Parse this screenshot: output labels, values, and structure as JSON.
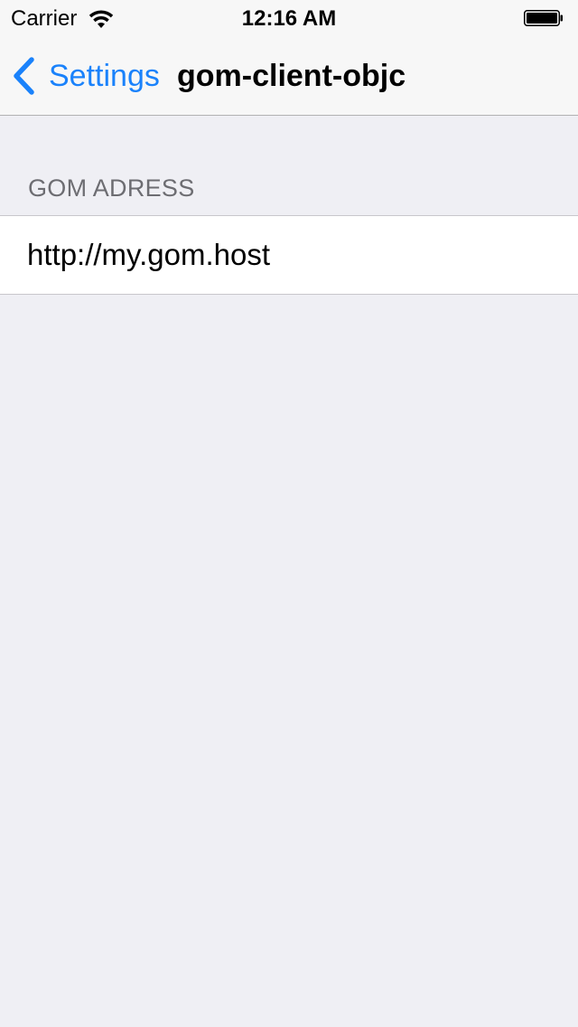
{
  "status_bar": {
    "carrier": "Carrier",
    "time": "12:16 AM",
    "wifi_icon": "wifi-icon",
    "battery_icon": "battery-icon"
  },
  "nav_bar": {
    "back_label": "Settings",
    "back_icon": "chevron-left-icon",
    "title": "gom-client-objc"
  },
  "section": {
    "header": "GOM ADRESS",
    "field_value": "http://my.gom.host"
  },
  "colors": {
    "accent": "#1a82fb",
    "background": "#efeff4",
    "bar_background": "#f7f7f7",
    "section_header_text": "#6d6d72",
    "separator": "#c8c7cc"
  }
}
